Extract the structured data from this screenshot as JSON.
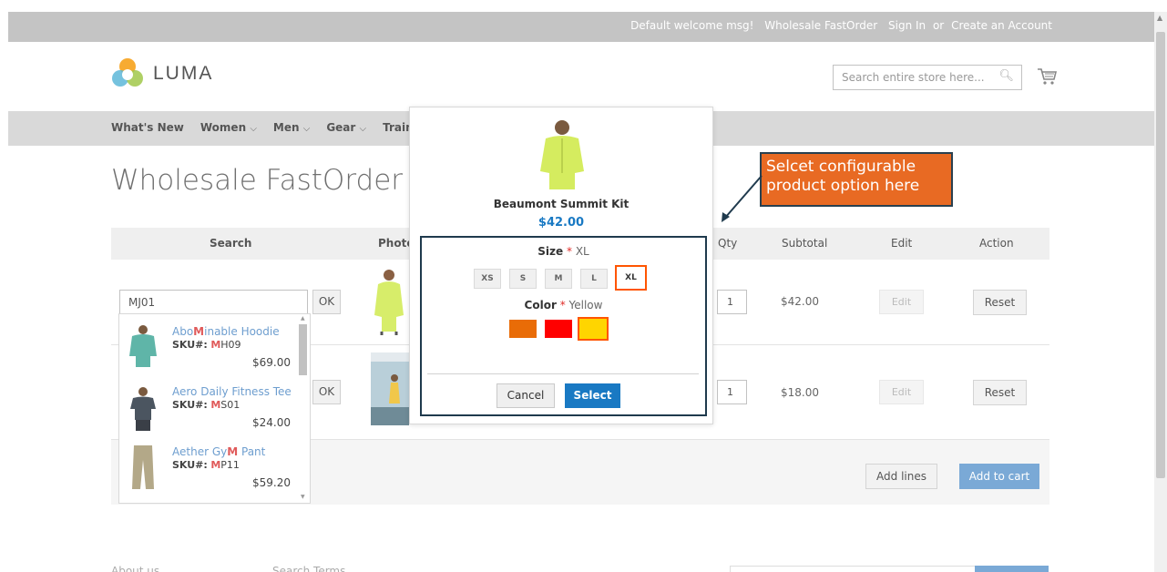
{
  "topbar": {
    "welcome": "Default welcome msg!",
    "fastorder": "Wholesale FastOrder",
    "sign_in": "Sign In",
    "or": "or",
    "create_account": "Create an Account"
  },
  "header": {
    "logo_text": "LUMA",
    "search_placeholder": "Search entire store here..."
  },
  "nav": {
    "items": [
      {
        "label": "What's New",
        "has_chevron": false
      },
      {
        "label": "Women",
        "has_chevron": true
      },
      {
        "label": "Men",
        "has_chevron": true
      },
      {
        "label": "Gear",
        "has_chevron": true
      },
      {
        "label": "Train",
        "has_chevron": false
      }
    ]
  },
  "page_title": "Wholesale FastOrder",
  "table": {
    "headers": {
      "search": "Search",
      "photo": "Photo",
      "qty": "Qty",
      "subtotal": "Subtotal",
      "edit": "Edit",
      "action": "Action"
    },
    "rows": [
      {
        "search_value": "MJ01",
        "ok": "OK",
        "qty": "1",
        "subtotal": "$42.00",
        "edit": "Edit",
        "reset": "Reset"
      },
      {
        "search_value": "",
        "ok": "OK",
        "qty": "1",
        "subtotal": "$18.00",
        "edit": "Edit",
        "reset": "Reset"
      }
    ],
    "add_lines": "Add lines",
    "add_to_cart": "Add to cart"
  },
  "autocomplete": {
    "items": [
      {
        "name_pre": "Abo",
        "name_hl": "M",
        "name_post": "inable Hoodie",
        "sku_label": "SKU#:",
        "sku_hl": "M",
        "sku_rest": "H09",
        "price": "$69.00"
      },
      {
        "name_pre": "Aero Daily Fitness Tee",
        "name_hl": "",
        "name_post": "",
        "sku_label": "SKU#:",
        "sku_hl": "M",
        "sku_rest": "S01",
        "price": "$24.00"
      },
      {
        "name_pre": "Aether Gy",
        "name_hl": "M",
        "name_post": " Pant",
        "sku_label": "SKU#:",
        "sku_hl": "M",
        "sku_rest": "P11",
        "price": "$59.20"
      }
    ]
  },
  "modal": {
    "product_name": "Beaumont Summit Kit",
    "price": "$42.00",
    "size_label": "Size",
    "size_required": "*",
    "size_value": "XL",
    "sizes": [
      "XS",
      "S",
      "M",
      "L",
      "XL"
    ],
    "selected_size": "XL",
    "color_label": "Color",
    "color_required": "*",
    "color_value": "Yellow",
    "colors": [
      "#e96c07",
      "#ff0000",
      "#ffd500"
    ],
    "selected_color_index": 2,
    "cancel": "Cancel",
    "select": "Select"
  },
  "callout": {
    "text": "Selcet configurable product option here"
  },
  "footer": {
    "about": "About us",
    "search_terms": "Search Terms"
  },
  "colors": {
    "primary_blue": "#1979c3",
    "highlight_orange": "#ff5501",
    "callout_bg": "#e86a23"
  }
}
